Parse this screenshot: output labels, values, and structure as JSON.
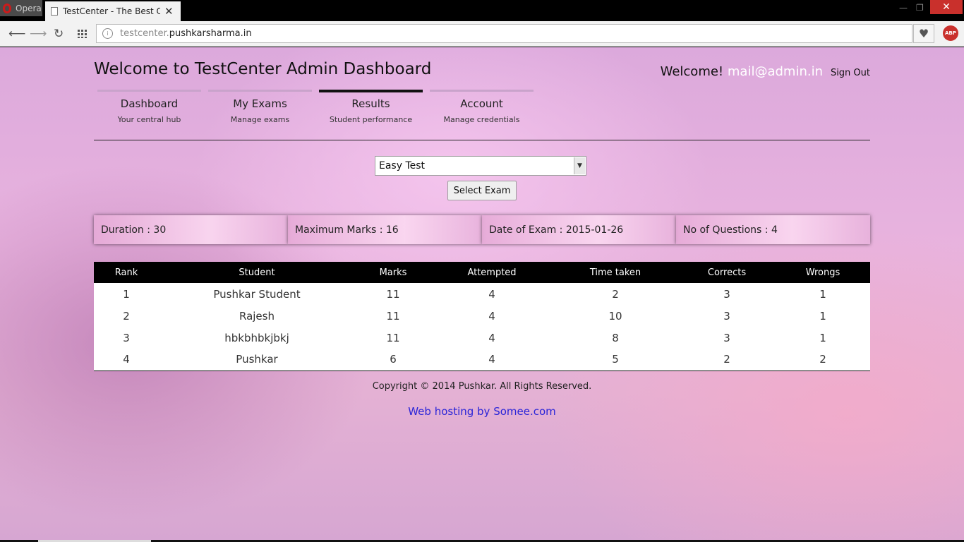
{
  "browser": {
    "menu_label": "Opera",
    "tab_title": "TestCenter - The Best Online",
    "url_prefix": "testcenter.",
    "url_domain": "pushkarsharma.in",
    "abp_badge": "ABP"
  },
  "header": {
    "title": "Welcome to TestCenter Admin Dashboard",
    "welcome_text": "Welcome!",
    "user_email": "mail@admin.in",
    "sign_out": "Sign Out"
  },
  "nav": {
    "items": [
      {
        "label": "Dashboard",
        "sub": "Your central hub"
      },
      {
        "label": "My Exams",
        "sub": "Manage exams"
      },
      {
        "label": "Results",
        "sub": "Student performance"
      },
      {
        "label": "Account",
        "sub": "Manage credentials"
      }
    ],
    "active_index": 2
  },
  "exam_select": {
    "selected": "Easy Test",
    "button_label": "Select Exam"
  },
  "stats": [
    "Duration : 30",
    "Maximum Marks : 16",
    "Date of Exam : 2015-01-26",
    "No of Questions : 4"
  ],
  "results": {
    "columns": [
      "Rank",
      "Student",
      "Marks",
      "Attempted",
      "Time taken",
      "Corrects",
      "Wrongs"
    ],
    "rows": [
      [
        "1",
        "Pushkar Student",
        "11",
        "4",
        "2",
        "3",
        "1"
      ],
      [
        "2",
        "Rajesh",
        "11",
        "4",
        "10",
        "3",
        "1"
      ],
      [
        "3",
        "hbkbhbkjbkj",
        "11",
        "4",
        "8",
        "3",
        "1"
      ],
      [
        "4",
        "Pushkar",
        "6",
        "4",
        "5",
        "2",
        "2"
      ]
    ]
  },
  "footer": {
    "copyright": "Copyright © 2014 Pushkar. All Rights Reserved.",
    "hosting": "Web hosting by Somee.com"
  },
  "colors": {
    "accent_link": "#2a24d8",
    "table_header": "#000000",
    "email": "#ffffff"
  }
}
